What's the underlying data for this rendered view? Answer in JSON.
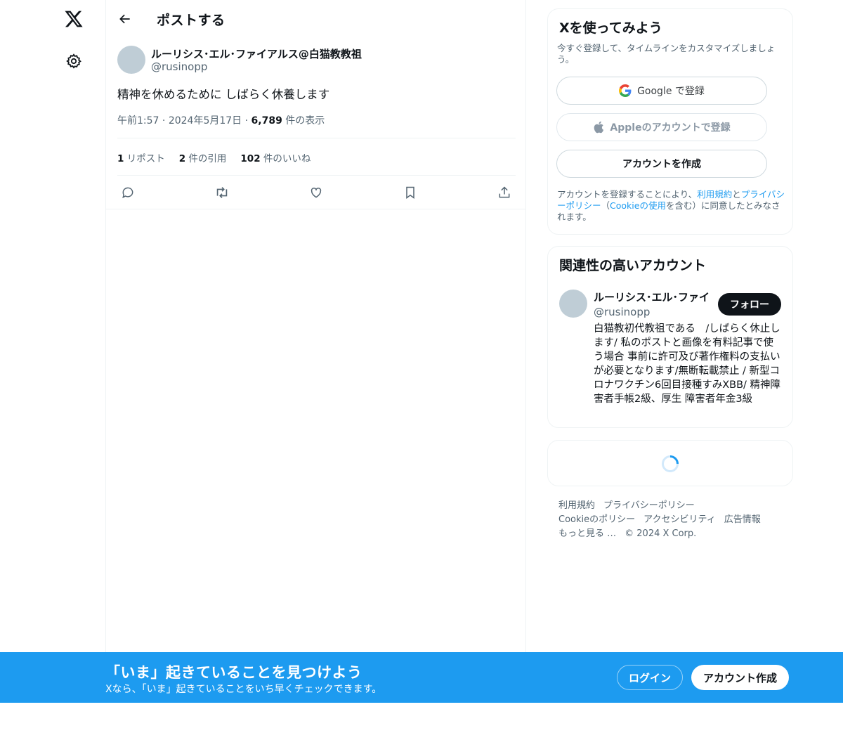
{
  "nav": {
    "logo_icon": "x-logo-icon",
    "settings_icon": "gear-icon"
  },
  "header": {
    "back_icon": "arrow-left-icon",
    "title": "ポストする"
  },
  "post": {
    "author_name": "ルーリシス･エル･ファイアルス@白猫教教祖",
    "author_handle": "@rusinopp",
    "text": "精神を休めるために しばらく休養します",
    "time": "午前1:57",
    "date": "2024年5月17日",
    "views_count": "6,789",
    "views_label": "件の表示",
    "stats": {
      "reposts_count": "1",
      "reposts_label": "リポスト",
      "quotes_count": "2",
      "quotes_label": "件の引用",
      "likes_count": "102",
      "likes_label": "件のいいね"
    },
    "actions": [
      "reply-icon",
      "repost-icon",
      "like-icon",
      "bookmark-icon",
      "share-icon"
    ]
  },
  "signup_card": {
    "title": "Xを使ってみよう",
    "subtitle": "今すぐ登録して、タイムラインをカスタマイズしましょう。",
    "google_label": "Google で登録",
    "apple_label": "Appleのアカウントで登録",
    "create_label": "アカウントを作成",
    "legal_prefix": "アカウントを登録することにより、",
    "legal_terms": "利用規約",
    "legal_and": "と",
    "legal_privacy": "プライバシーポリシー",
    "legal_paren_open": "（",
    "legal_cookie": "Cookieの使用",
    "legal_suffix": "を含む）に同意したとみなされます。"
  },
  "related_card": {
    "title": "関連性の高いアカウント",
    "name": "ルーリシス･エル･ファイ",
    "handle": "@rusinopp",
    "follow_label": "フォロー",
    "bio": "白猫教初代教祖である　/しばらく休止します/ 私のポストと画像を有料記事で使う場合 事前に許可及び著作権料の支払いが必要となります/無断転載禁止 / 新型コロナワクチン6回目接種すみXBB/ 精神障害者手帳2級、厚生 障害者年金3級"
  },
  "footer": {
    "links": [
      "利用規約",
      "プライバシーポリシー",
      "Cookieのポリシー",
      "アクセシビリティ",
      "広告情報",
      "もっと見る …",
      "© 2024 X Corp."
    ]
  },
  "banner": {
    "title": "「いま」起きていることを見つけよう",
    "subtitle": "Xなら、「いま」起きていることをいち早くチェックできます。",
    "login_label": "ログイン",
    "signup_label": "アカウント作成"
  },
  "colors": {
    "accent": "#1d9bf0",
    "text": "#0f1419",
    "secondary": "#536471",
    "border": "#eff3f4"
  }
}
